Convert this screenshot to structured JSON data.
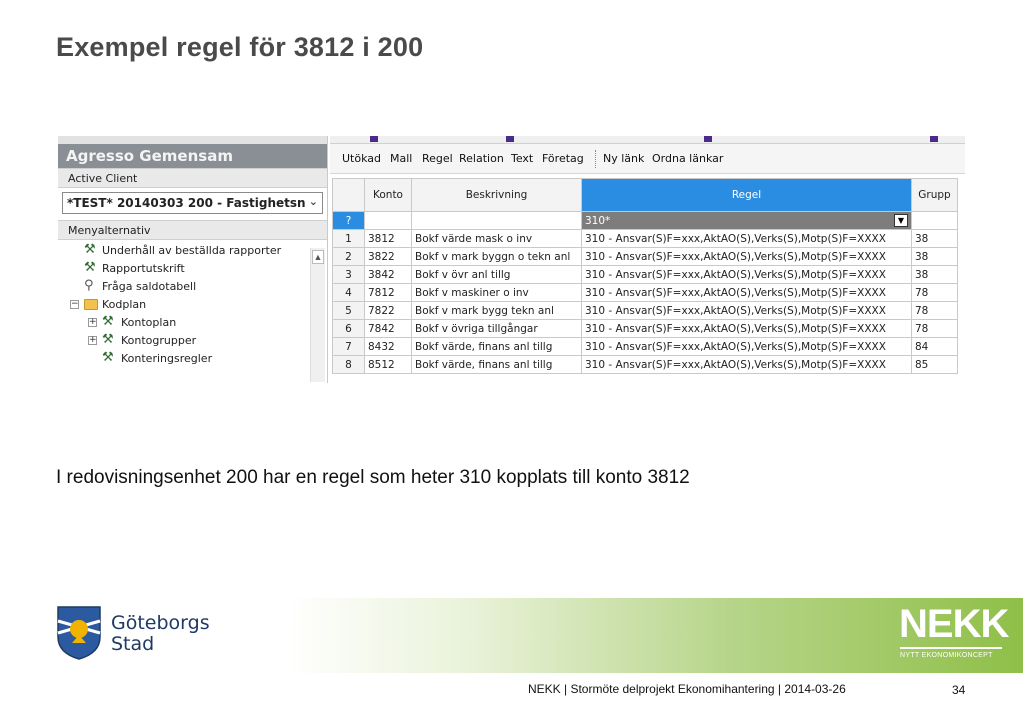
{
  "slide": {
    "title": "Exempel regel för 3812 i 200",
    "caption": "I redovisningsenhet 200 har en regel som heter 310 kopplats till konto 3812",
    "footer": "NEKK | Stormöte delprojekt Ekonomihantering | 2014-03-26",
    "page_number": "34"
  },
  "app": {
    "title": "Agresso Gemensam",
    "active_client_label": "Active Client",
    "active_client_value": "*TEST* 20140303 200 - Fastighetsn",
    "menu_label": "Menyalternativ",
    "menu_items": [
      {
        "label": "Underhåll av beställda rapporter",
        "icon": "tool-icon"
      },
      {
        "label": "Rapportutskrift",
        "icon": "tool-icon"
      },
      {
        "label": "Fråga saldotabell",
        "icon": "magnifier-icon"
      },
      {
        "label": "Kodplan",
        "icon": "folder-icon"
      },
      {
        "label": "Kontoplan",
        "icon": "tool-icon"
      },
      {
        "label": "Kontogrupper",
        "icon": "tool-icon"
      },
      {
        "label": "Konteringsregler",
        "icon": "tool-icon"
      }
    ]
  },
  "toolbar": {
    "items": [
      "Utökad",
      "Mall",
      "Regel",
      "Relation",
      "Text",
      "Företag",
      "Ny länk",
      "Ordna länkar"
    ]
  },
  "grid": {
    "columns": [
      "Konto",
      "Beskrivning",
      "Regel",
      "Grupp"
    ],
    "filter_marker": "?",
    "filter_regel": "310*",
    "rows": [
      {
        "n": "1",
        "konto": "3812",
        "beskrivning": "Bokf värde mask o inv",
        "regel": "310 - Ansvar(S)F=xxx,AktAO(S),Verks(S),Motp(S)F=XXXX",
        "grupp": "38"
      },
      {
        "n": "2",
        "konto": "3822",
        "beskrivning": "Bokf v mark byggn o tekn anl",
        "regel": "310 - Ansvar(S)F=xxx,AktAO(S),Verks(S),Motp(S)F=XXXX",
        "grupp": "38"
      },
      {
        "n": "3",
        "konto": "3842",
        "beskrivning": "Bokf v övr anl tillg",
        "regel": "310 - Ansvar(S)F=xxx,AktAO(S),Verks(S),Motp(S)F=XXXX",
        "grupp": "38"
      },
      {
        "n": "4",
        "konto": "7812",
        "beskrivning": "Bokf v maskiner o inv",
        "regel": "310 - Ansvar(S)F=xxx,AktAO(S),Verks(S),Motp(S)F=XXXX",
        "grupp": "78"
      },
      {
        "n": "5",
        "konto": "7822",
        "beskrivning": "Bokf v mark bygg tekn anl",
        "regel": "310 - Ansvar(S)F=xxx,AktAO(S),Verks(S),Motp(S)F=XXXX",
        "grupp": "78"
      },
      {
        "n": "6",
        "konto": "7842",
        "beskrivning": "Bokf v övriga tillgångar",
        "regel": "310 - Ansvar(S)F=xxx,AktAO(S),Verks(S),Motp(S)F=XXXX",
        "grupp": "78"
      },
      {
        "n": "7",
        "konto": "8432",
        "beskrivning": "Bokf värde, finans anl tillg",
        "regel": "310 - Ansvar(S)F=xxx,AktAO(S),Verks(S),Motp(S)F=XXXX",
        "grupp": "84"
      },
      {
        "n": "8",
        "konto": "8512",
        "beskrivning": "Bokf värde, finans anl tillg",
        "regel": "310 - Ansvar(S)F=xxx,AktAO(S),Verks(S),Motp(S)F=XXXX",
        "grupp": "85"
      }
    ]
  },
  "logos": {
    "city_name": "Göteborgs",
    "city_name_2": "Stad",
    "nekk_word": "NEKK",
    "nekk_sub": "NYTT EKONOMIKONCEPT"
  },
  "colors": {
    "selected_column": "#2b8de2",
    "app_title_bar": "#8a8f96",
    "nekk_green": "#8fbf48",
    "city_blue": "#1f3a64"
  }
}
